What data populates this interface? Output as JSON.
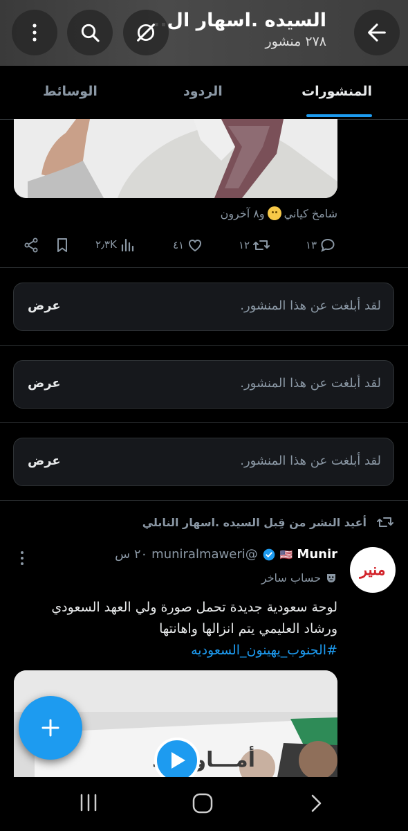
{
  "header": {
    "title": "السيده .اسهار ال..",
    "post_count": "٢٧٨ منشور"
  },
  "tabs": [
    {
      "label": "المنشورات",
      "active": true
    },
    {
      "label": "الردود",
      "active": false
    },
    {
      "label": "الوسائط",
      "active": false
    }
  ],
  "post1": {
    "liked_by": "شامخ كياني",
    "liked_others": "و٨ آخرون",
    "stats": {
      "replies": "١٣",
      "reposts": "١٢",
      "likes": "٤١",
      "views": "٢٫٣K"
    }
  },
  "reports": [
    {
      "message": "لقد أبلغت عن هذا المنشور.",
      "action": "عرض"
    },
    {
      "message": "لقد أبلغت عن هذا المنشور.",
      "action": "عرض"
    },
    {
      "message": "لقد أبلغت عن هذا المنشور.",
      "action": "عرض"
    }
  ],
  "repost": {
    "label": "أعيد النشر من قِبل السيده .اسهار النابلي"
  },
  "tweet": {
    "name": "Munir",
    "flag": "🇺🇸",
    "handle": "@muniralmaweri",
    "time": "٢٠ س",
    "account_label": "حساب ساخر",
    "text_line1": "لوحة سعودية جديدة تحمل صورة ولي العهد السعودي",
    "text_line2": "ورشاد العليمي يتم انزالها واهانتها",
    "hashtag": "#الجنوب_يهينون_السعوديه",
    "avatar_text": "منير",
    "video_caption": "أمـــاواحـد"
  },
  "colors": {
    "accent": "#1d9bf0",
    "background": "#000000",
    "muted": "#8b98a5",
    "border": "#2f3336"
  }
}
